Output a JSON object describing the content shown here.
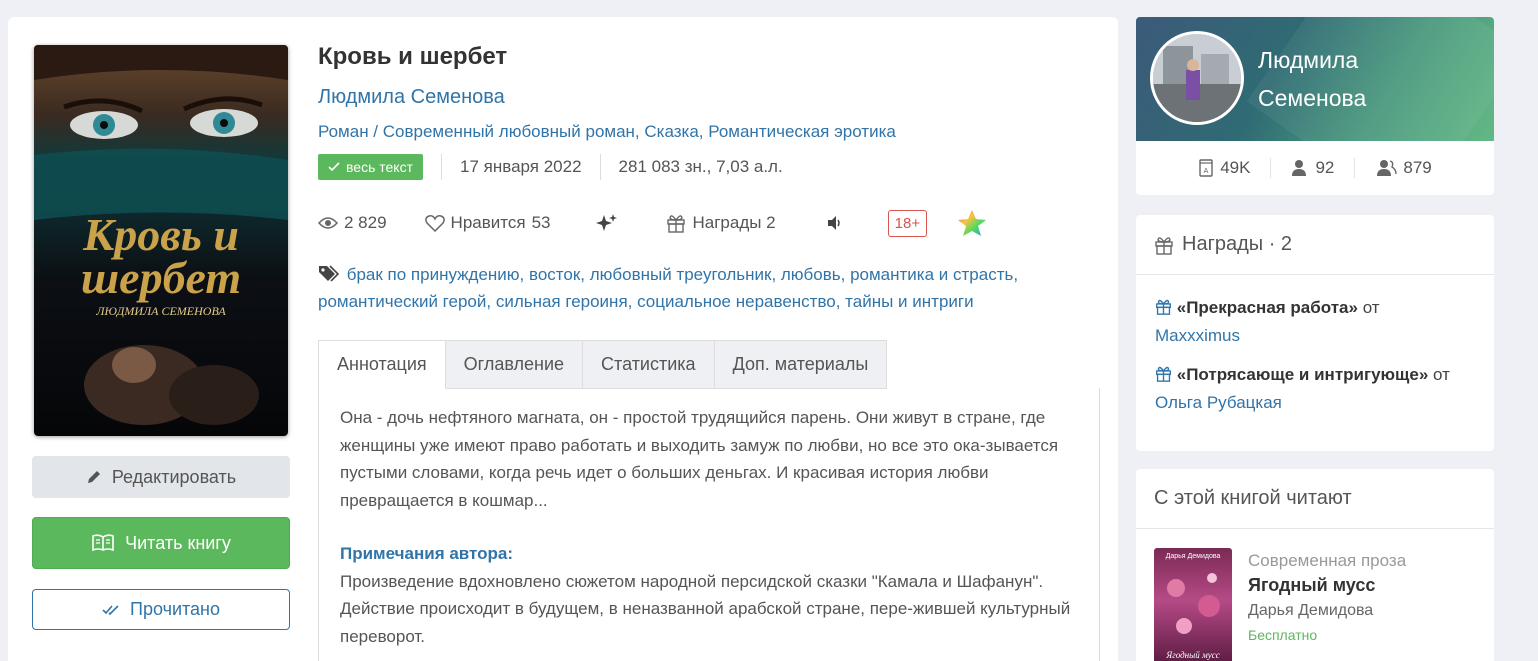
{
  "book": {
    "title": "Кровь и шербет",
    "author": "Людмила Семенова",
    "genres": "Роман / Современный любовный роман, Сказка, Романтическая эротика",
    "badge": "весь текст",
    "date": "17 января 2022",
    "size": "281 083 зн., 7,03 а.л.",
    "views": "2 829",
    "likes_label": "Нравится",
    "likes": "53",
    "awards_label": "Награды 2",
    "age": "18+",
    "tags": "брак по принуждению, восток, любовный треугольник, любовь, романтика и страсть, романтический герой, сильная героиня, социальное неравенство, тайны и интриги",
    "cover": {
      "title_line1": "Кровь и",
      "title_line2": "шербет",
      "author": "ЛЮДМИЛА СЕМЕНОВА"
    }
  },
  "buttons": {
    "edit": "Редактировать",
    "read": "Читать книгу",
    "done": "Прочитано"
  },
  "tabs": [
    "Аннотация",
    "Оглавление",
    "Статистика",
    "Доп. материалы"
  ],
  "annotation": {
    "text": "Она - дочь нефтяного магната, он - простой трудящийся парень. Они живут в стране, где женщины уже имеют право работать и выходить замуж по любви, но все это ока-зывается пустыми словами, когда речь идет о больших деньгах. И красивая история любви превращается в кошмар...",
    "notes_heading": "Примечания автора:",
    "notes": "Произведение вдохновлено сюжетом народной персидской сказки \"Камала и Шафанун\". Действие происходит в будущем, в неназванной арабской стране, пере-жившей культурный переворот."
  },
  "profile": {
    "name_line1": "Людмила",
    "name_line2": "Семенова",
    "stats": [
      "49K",
      "92",
      "879"
    ]
  },
  "awards": {
    "heading": "Награды · 2",
    "items": [
      {
        "name": "«Прекрасная работа»",
        "from": "от",
        "user": "Maxxximus"
      },
      {
        "name": "«Потрясающе и интригующе»",
        "from": "от",
        "user": "Ольга Рубацкая"
      }
    ]
  },
  "readers": {
    "heading": "С этой книгой читают",
    "item": {
      "genre": "Современная проза",
      "title": "Ягодный мусс",
      "author": "Дарья Демидова",
      "price": "Бесплатно",
      "cover_author": "Дарья Демидова",
      "cover_title": "Ягодный мусс"
    }
  },
  "colors": {
    "accent": "#3174a8",
    "green": "#5cb85c",
    "red": "#d9534f"
  }
}
